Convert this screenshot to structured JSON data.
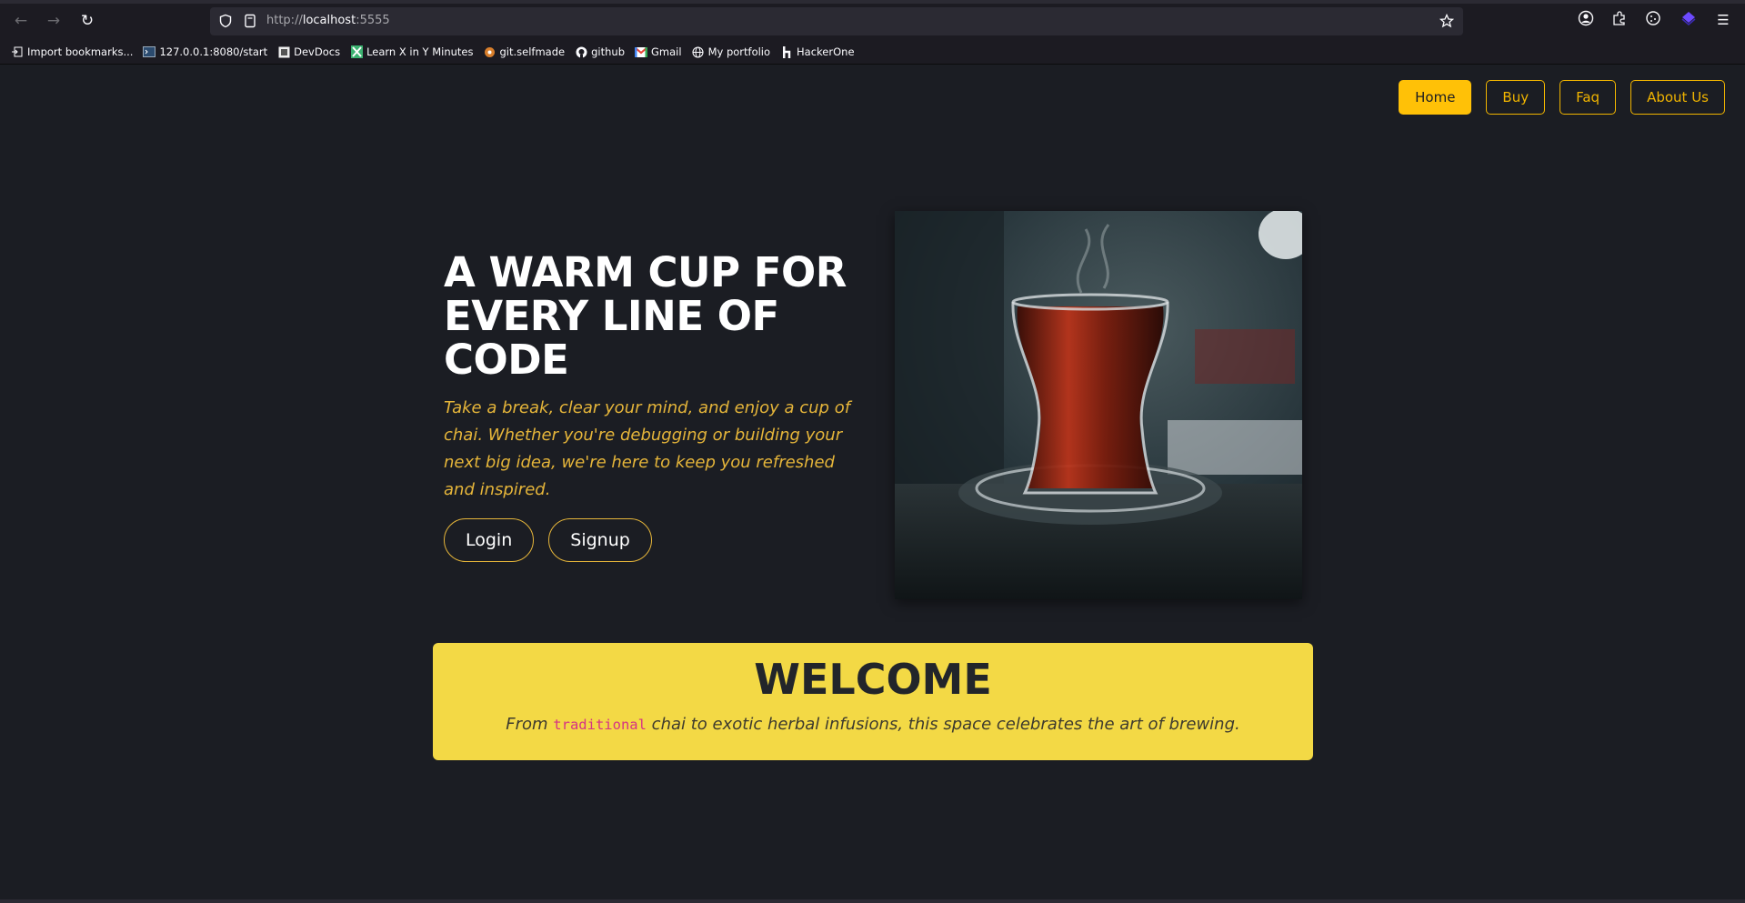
{
  "browser": {
    "url_scheme": "http://",
    "url_host": "localhost",
    "url_port": ":5555",
    "bookmarks": [
      {
        "label": "Import bookmarks...",
        "icon": "import-icon"
      },
      {
        "label": "127.0.0.1:8080/start",
        "icon": "terminal-icon"
      },
      {
        "label": "DevDocs",
        "icon": "devdocs-icon"
      },
      {
        "label": "Learn X in Y Minutes",
        "icon": "x-icon"
      },
      {
        "label": "git.selfmade",
        "icon": "git-icon"
      },
      {
        "label": "github",
        "icon": "github-icon"
      },
      {
        "label": "Gmail",
        "icon": "gmail-icon"
      },
      {
        "label": "My portfolio",
        "icon": "globe-icon"
      },
      {
        "label": "HackerOne",
        "icon": "hackerone-icon"
      }
    ]
  },
  "nav": {
    "home": "Home",
    "buy": "Buy",
    "faq": "Faq",
    "about": "About Us"
  },
  "hero": {
    "title": "A WARM CUP FOR EVERY LINE OF CODE",
    "subtitle": "Take a break, clear your mind, and enjoy a cup of chai. Whether you're debugging or building your next big idea, we're here to keep you refreshed and inspired.",
    "login": "Login",
    "signup": "Signup"
  },
  "welcome": {
    "title": "WELCOME",
    "text_before": "From ",
    "code_word": "traditional",
    "text_after": " chai to exotic herbal infusions, this space celebrates the art of brewing."
  },
  "colors": {
    "background": "#1b1d23",
    "accent": "#ffc107",
    "welcome_bg": "#f3d945",
    "code_pink": "#d63384"
  }
}
